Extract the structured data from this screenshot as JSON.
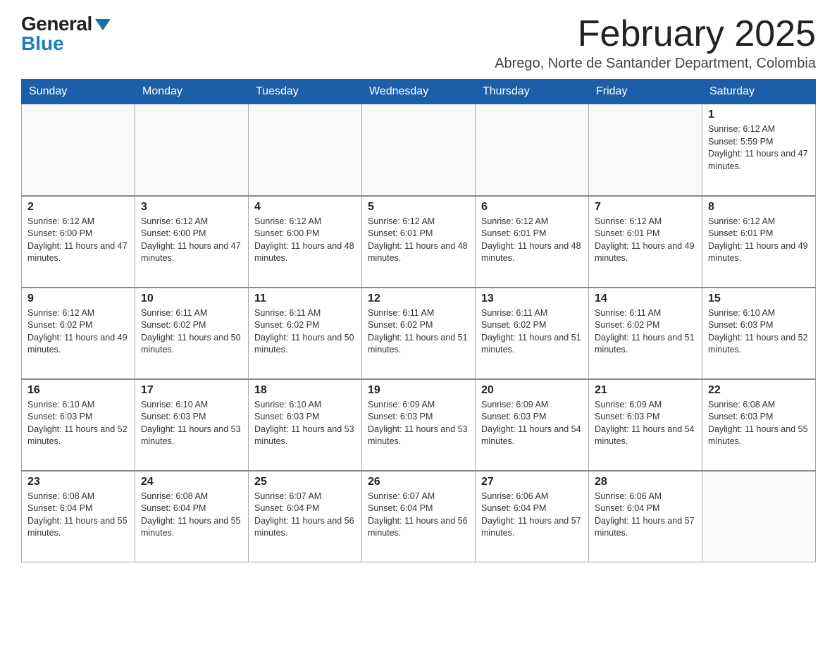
{
  "logo": {
    "general": "General",
    "blue": "Blue"
  },
  "title": "February 2025",
  "subtitle": "Abrego, Norte de Santander Department, Colombia",
  "days_of_week": [
    "Sunday",
    "Monday",
    "Tuesday",
    "Wednesday",
    "Thursday",
    "Friday",
    "Saturday"
  ],
  "weeks": [
    {
      "days": [
        {
          "number": "",
          "info": ""
        },
        {
          "number": "",
          "info": ""
        },
        {
          "number": "",
          "info": ""
        },
        {
          "number": "",
          "info": ""
        },
        {
          "number": "",
          "info": ""
        },
        {
          "number": "",
          "info": ""
        },
        {
          "number": "1",
          "info": "Sunrise: 6:12 AM\nSunset: 5:59 PM\nDaylight: 11 hours and 47 minutes."
        }
      ]
    },
    {
      "days": [
        {
          "number": "2",
          "info": "Sunrise: 6:12 AM\nSunset: 6:00 PM\nDaylight: 11 hours and 47 minutes."
        },
        {
          "number": "3",
          "info": "Sunrise: 6:12 AM\nSunset: 6:00 PM\nDaylight: 11 hours and 47 minutes."
        },
        {
          "number": "4",
          "info": "Sunrise: 6:12 AM\nSunset: 6:00 PM\nDaylight: 11 hours and 48 minutes."
        },
        {
          "number": "5",
          "info": "Sunrise: 6:12 AM\nSunset: 6:01 PM\nDaylight: 11 hours and 48 minutes."
        },
        {
          "number": "6",
          "info": "Sunrise: 6:12 AM\nSunset: 6:01 PM\nDaylight: 11 hours and 48 minutes."
        },
        {
          "number": "7",
          "info": "Sunrise: 6:12 AM\nSunset: 6:01 PM\nDaylight: 11 hours and 49 minutes."
        },
        {
          "number": "8",
          "info": "Sunrise: 6:12 AM\nSunset: 6:01 PM\nDaylight: 11 hours and 49 minutes."
        }
      ]
    },
    {
      "days": [
        {
          "number": "9",
          "info": "Sunrise: 6:12 AM\nSunset: 6:02 PM\nDaylight: 11 hours and 49 minutes."
        },
        {
          "number": "10",
          "info": "Sunrise: 6:11 AM\nSunset: 6:02 PM\nDaylight: 11 hours and 50 minutes."
        },
        {
          "number": "11",
          "info": "Sunrise: 6:11 AM\nSunset: 6:02 PM\nDaylight: 11 hours and 50 minutes."
        },
        {
          "number": "12",
          "info": "Sunrise: 6:11 AM\nSunset: 6:02 PM\nDaylight: 11 hours and 51 minutes."
        },
        {
          "number": "13",
          "info": "Sunrise: 6:11 AM\nSunset: 6:02 PM\nDaylight: 11 hours and 51 minutes."
        },
        {
          "number": "14",
          "info": "Sunrise: 6:11 AM\nSunset: 6:02 PM\nDaylight: 11 hours and 51 minutes."
        },
        {
          "number": "15",
          "info": "Sunrise: 6:10 AM\nSunset: 6:03 PM\nDaylight: 11 hours and 52 minutes."
        }
      ]
    },
    {
      "days": [
        {
          "number": "16",
          "info": "Sunrise: 6:10 AM\nSunset: 6:03 PM\nDaylight: 11 hours and 52 minutes."
        },
        {
          "number": "17",
          "info": "Sunrise: 6:10 AM\nSunset: 6:03 PM\nDaylight: 11 hours and 53 minutes."
        },
        {
          "number": "18",
          "info": "Sunrise: 6:10 AM\nSunset: 6:03 PM\nDaylight: 11 hours and 53 minutes."
        },
        {
          "number": "19",
          "info": "Sunrise: 6:09 AM\nSunset: 6:03 PM\nDaylight: 11 hours and 53 minutes."
        },
        {
          "number": "20",
          "info": "Sunrise: 6:09 AM\nSunset: 6:03 PM\nDaylight: 11 hours and 54 minutes."
        },
        {
          "number": "21",
          "info": "Sunrise: 6:09 AM\nSunset: 6:03 PM\nDaylight: 11 hours and 54 minutes."
        },
        {
          "number": "22",
          "info": "Sunrise: 6:08 AM\nSunset: 6:03 PM\nDaylight: 11 hours and 55 minutes."
        }
      ]
    },
    {
      "days": [
        {
          "number": "23",
          "info": "Sunrise: 6:08 AM\nSunset: 6:04 PM\nDaylight: 11 hours and 55 minutes."
        },
        {
          "number": "24",
          "info": "Sunrise: 6:08 AM\nSunset: 6:04 PM\nDaylight: 11 hours and 55 minutes."
        },
        {
          "number": "25",
          "info": "Sunrise: 6:07 AM\nSunset: 6:04 PM\nDaylight: 11 hours and 56 minutes."
        },
        {
          "number": "26",
          "info": "Sunrise: 6:07 AM\nSunset: 6:04 PM\nDaylight: 11 hours and 56 minutes."
        },
        {
          "number": "27",
          "info": "Sunrise: 6:06 AM\nSunset: 6:04 PM\nDaylight: 11 hours and 57 minutes."
        },
        {
          "number": "28",
          "info": "Sunrise: 6:06 AM\nSunset: 6:04 PM\nDaylight: 11 hours and 57 minutes."
        },
        {
          "number": "",
          "info": ""
        }
      ]
    }
  ]
}
